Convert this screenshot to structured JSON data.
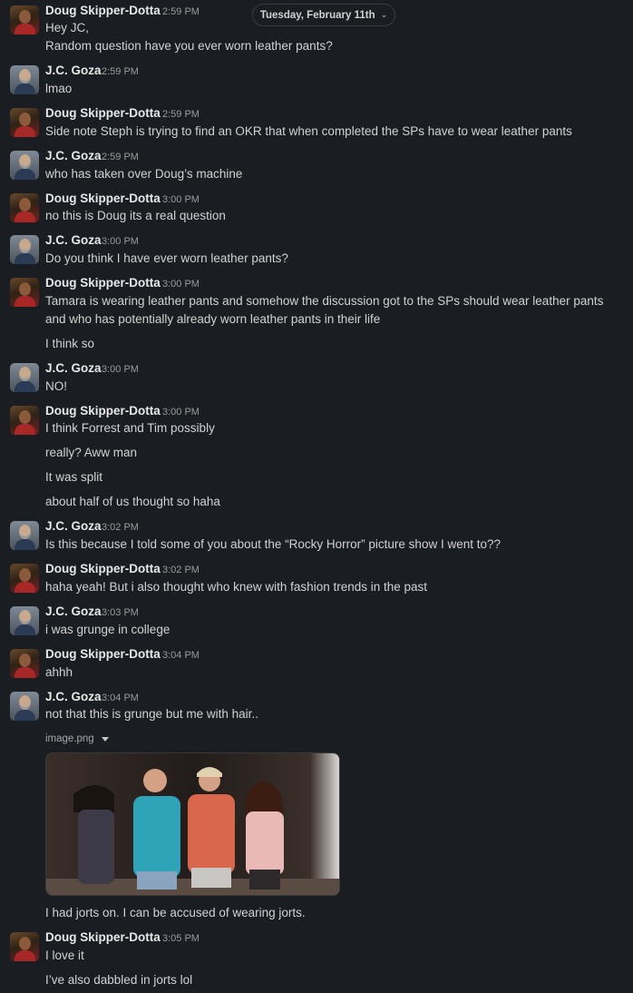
{
  "date_divider": {
    "label": "Tuesday, February 11th"
  },
  "users": {
    "doug": "Doug Skipper-Dotta",
    "jc": "J.C. Goza"
  },
  "messages": [
    {
      "sender": "Doug Skipper-Dotta",
      "time": "2:59 PM",
      "lines": [
        "Hey JC,",
        "Random question have you ever worn leather pants?"
      ]
    },
    {
      "sender": "J.C. Goza",
      "time": "2:59 PM",
      "lines": [
        "lmao"
      ]
    },
    {
      "sender": "Doug Skipper-Dotta",
      "time": "2:59 PM",
      "lines": [
        "Side note Steph is trying to find an OKR that when completed the SPs have to wear leather pants"
      ]
    },
    {
      "sender": "J.C. Goza",
      "time": "2:59 PM",
      "lines": [
        "who has taken over Doug’s machine"
      ]
    },
    {
      "sender": "Doug Skipper-Dotta",
      "time": "3:00 PM",
      "lines": [
        "no this is Doug its a real question"
      ]
    },
    {
      "sender": "J.C. Goza",
      "time": "3:00 PM",
      "lines": [
        "Do you think I have ever worn leather pants?"
      ]
    },
    {
      "sender": "Doug Skipper-Dotta",
      "time": "3:00 PM",
      "lines": [
        "Tamara is wearing leather pants and somehow the discussion got to the SPs should wear leather pants and who has potentially already worn leather pants in their life",
        "I think so"
      ]
    },
    {
      "sender": "J.C. Goza",
      "time": "3:00 PM",
      "lines": [
        "NO!"
      ]
    },
    {
      "sender": "Doug Skipper-Dotta",
      "time": "3:00 PM",
      "lines": [
        "I think Forrest and Tim possibly",
        "really? Aww man",
        "It was split",
        "about half of us thought so haha"
      ]
    },
    {
      "sender": "J.C. Goza",
      "time": "3:02 PM",
      "lines": [
        "Is this because I told some of you about the “Rocky Horror” picture show I went to??"
      ]
    },
    {
      "sender": "Doug Skipper-Dotta",
      "time": "3:02 PM",
      "lines": [
        "haha yeah! But i also thought who knew with fashion trends in the past"
      ]
    },
    {
      "sender": "J.C. Goza",
      "time": "3:03 PM",
      "lines": [
        "i was grunge in college"
      ]
    },
    {
      "sender": "Doug Skipper-Dotta",
      "time": "3:04 PM",
      "lines": [
        "ahhh"
      ]
    },
    {
      "sender": "J.C. Goza",
      "time": "3:04 PM",
      "lines": [
        "not that this is grunge but me with hair..",
        "I had jorts on. I can be accused of wearing jorts."
      ],
      "attachment": {
        "filename": "image.png"
      }
    },
    {
      "sender": "Doug Skipper-Dotta",
      "time": "3:05 PM",
      "lines": [
        "I love it",
        "I’ve also dabbled in jorts lol"
      ]
    }
  ]
}
